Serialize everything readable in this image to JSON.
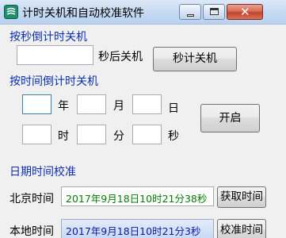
{
  "window": {
    "title": "计时关机和自动校准软件",
    "minimize_icon": "minimize-icon",
    "maximize_icon": "maximize-icon",
    "close_icon": "close-icon",
    "close_glyph": "✕"
  },
  "countdown_seconds": {
    "title": "按秒倒计时关机",
    "seconds_value": "",
    "suffix_label": "秒后关机",
    "button_label": "秒计关机"
  },
  "countdown_time": {
    "title": "按时间倒计时关机",
    "year_value": "",
    "year_label": "年",
    "month_value": "",
    "month_label": "月",
    "day_value": "",
    "day_label": "日",
    "hour_value": "",
    "hour_label": "时",
    "minute_value": "",
    "minute_label": "分",
    "second_value": "",
    "second_label": "秒",
    "start_button_label": "开启"
  },
  "calibration": {
    "title": "日期时间校准",
    "beijing_label": "北京时间",
    "beijing_time": "2017年9月18日10时21分38秒",
    "get_time_button_label": "获取时间",
    "local_label": "本地时间",
    "local_time": "2017年9月18日10时21分3秒",
    "calibrate_button_label": "校准时间"
  },
  "colors": {
    "section_title": "#0b2fb0",
    "beijing_time_text": "#0a7a0a",
    "local_time_text": "#0a1aa0"
  }
}
